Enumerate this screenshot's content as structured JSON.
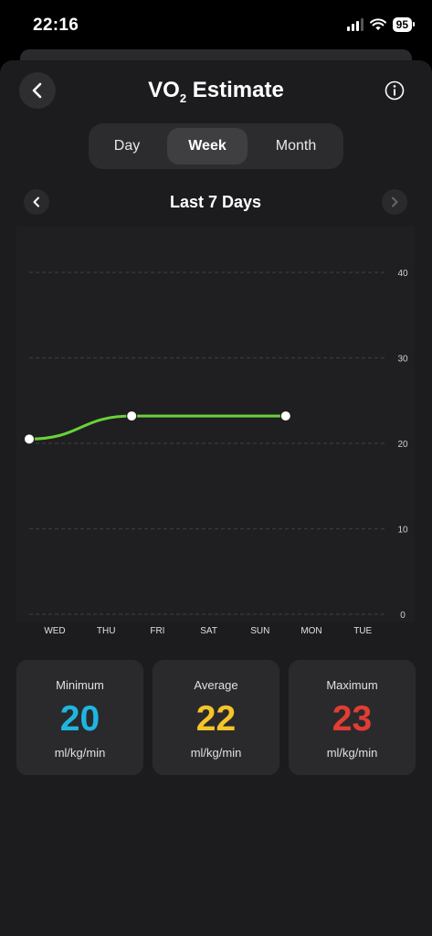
{
  "status_bar": {
    "time": "22:16",
    "battery": "95"
  },
  "header": {
    "title_main": "VO",
    "title_sub": "2",
    "title_rest": " Estimate"
  },
  "tabs": [
    {
      "label": "Day",
      "active": false
    },
    {
      "label": "Week",
      "active": true
    },
    {
      "label": "Month",
      "active": false
    }
  ],
  "period": {
    "label": "Last 7 Days"
  },
  "chart_data": {
    "type": "line",
    "categories": [
      "WED",
      "THU",
      "FRI",
      "SAT",
      "SUN",
      "MON",
      "TUE"
    ],
    "x": [
      0,
      2,
      5
    ],
    "values": [
      20.5,
      23.2,
      23.2
    ],
    "ylim": [
      0,
      40
    ],
    "yticks": [
      "40",
      "30",
      "20",
      "10",
      "0"
    ],
    "ytick_values": [
      40,
      30,
      20,
      10,
      0
    ],
    "grid": true,
    "line_color": "#6ad13a",
    "point_color": "#ffffff"
  },
  "stats": [
    {
      "label": "Minimum",
      "value": "20",
      "unit": "ml/kg/min",
      "color": "#1eb6e0"
    },
    {
      "label": "Average",
      "value": "22",
      "unit": "ml/kg/min",
      "color": "#f4c42b"
    },
    {
      "label": "Maximum",
      "value": "23",
      "unit": "ml/kg/min",
      "color": "#e23d33"
    }
  ],
  "icons": {
    "back": "chevron-left-icon",
    "info": "info-icon",
    "prev": "chevron-left-icon",
    "next": "chevron-right-icon"
  }
}
